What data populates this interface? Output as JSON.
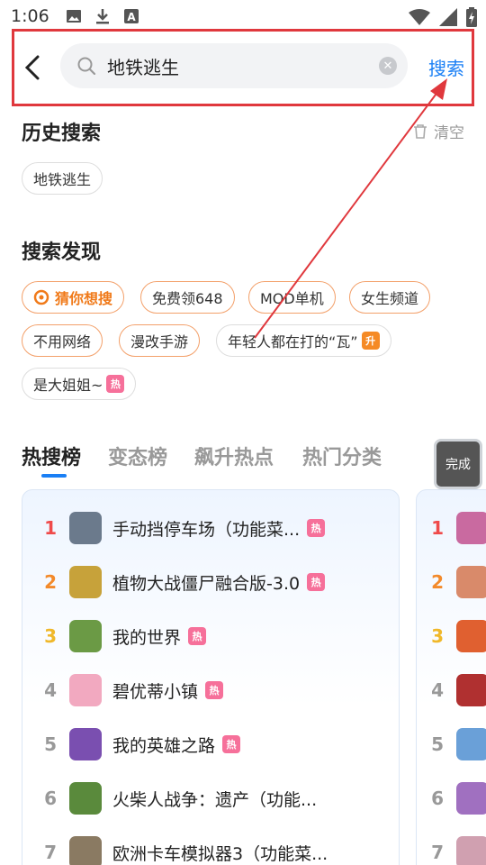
{
  "status_bar": {
    "time": "1:06"
  },
  "search": {
    "query": "地铁逃生",
    "button_label": "搜索"
  },
  "history": {
    "title": "历史搜索",
    "clear_label": "清空",
    "items": [
      "地铁逃生"
    ]
  },
  "discover": {
    "title": "搜索发现",
    "items": [
      {
        "label": "猜你想搜"
      },
      {
        "label": "免费领648"
      },
      {
        "label": "MOD单机"
      },
      {
        "label": "女生频道"
      },
      {
        "label": "不用网络"
      },
      {
        "label": "漫改手游"
      },
      {
        "label": "年轻人都在打的“瓦”",
        "badge": "升"
      },
      {
        "label": "是大姐姐~",
        "badge": "热"
      }
    ]
  },
  "tabs": [
    "热搜榜",
    "变态榜",
    "飙升热点",
    "热门分类"
  ],
  "done_label": "完成",
  "ranking": [
    {
      "rank": "1",
      "name": "手动挡停车场（功能菜...",
      "badge": "热",
      "icon_color": "#6b7a8c"
    },
    {
      "rank": "2",
      "name": "植物大战僵尸融合版-3.0",
      "badge": "热",
      "icon_color": "#c7a23a"
    },
    {
      "rank": "3",
      "name": "我的世界",
      "badge": "热",
      "icon_color": "#6b9a45"
    },
    {
      "rank": "4",
      "name": "碧优蒂小镇",
      "badge": "热",
      "icon_color": "#f2a9c0"
    },
    {
      "rank": "5",
      "name": "我的英雄之路",
      "badge": "热",
      "icon_color": "#7a4fb0"
    },
    {
      "rank": "6",
      "name": "火柴人战争：遗产（功能...",
      "badge": "",
      "icon_color": "#5a8a3c"
    },
    {
      "rank": "7",
      "name": "欧洲卡车模拟器3（功能菜...",
      "badge": "",
      "icon_color": "#8a7a62"
    }
  ],
  "ranking_2": [
    {
      "rank": "1",
      "icon_color": "#c96aa0"
    },
    {
      "rank": "2",
      "icon_color": "#d98a6a"
    },
    {
      "rank": "3",
      "icon_color": "#e06030"
    },
    {
      "rank": "4",
      "icon_color": "#b03030"
    },
    {
      "rank": "5",
      "icon_color": "#6aa0d8"
    },
    {
      "rank": "6",
      "icon_color": "#a070c0"
    },
    {
      "rank": "7",
      "icon_color": "#d0a0b0"
    }
  ],
  "colors": {
    "accent": "#1a7ff5",
    "highlight_box": "#e0383d"
  }
}
